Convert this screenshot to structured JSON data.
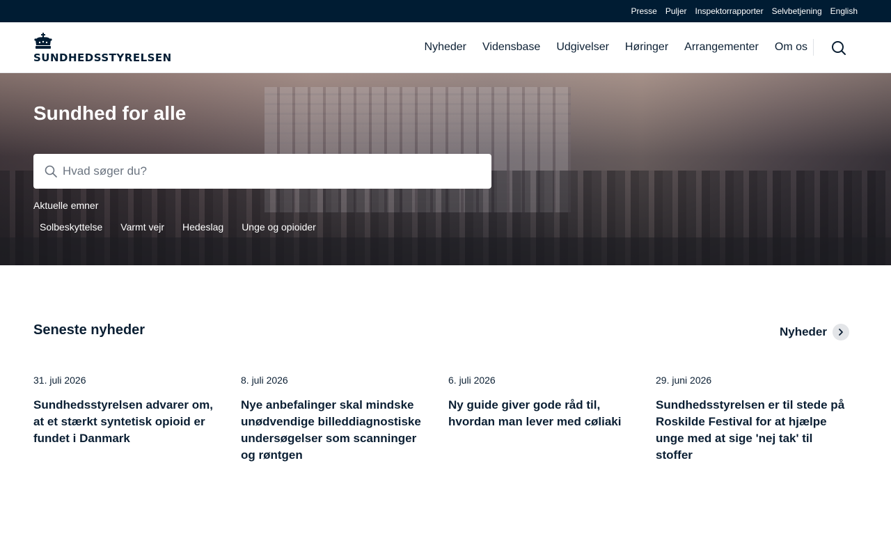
{
  "topbar": {
    "links": [
      "Presse",
      "Puljer",
      "Inspektorrapporter",
      "Selvbetjening",
      "English"
    ]
  },
  "header": {
    "logo_text": "SUNDHEDSSTYRELSEN",
    "nav": [
      "Nyheder",
      "Vidensbase",
      "Udgivelser",
      "Høringer",
      "Arrangementer",
      "Om os"
    ],
    "search_icon": "search-icon"
  },
  "hero": {
    "title": "Sundhed for alle",
    "search": {
      "placeholder": "Hvad søger du?",
      "value": ""
    },
    "topics_label": "Aktuelle emner",
    "topics": [
      "Solbeskyttelse",
      "Varmt vejr",
      "Hedeslag",
      "Unge og opioider"
    ]
  },
  "news": {
    "title": "Seneste nyheder",
    "more_label": "Nyheder",
    "items": [
      {
        "date": "31. juli 2026",
        "headline": "Sundhedsstyrelsen advarer om, at et stærkt syntetisk opioid er fundet i Danmark"
      },
      {
        "date": "8. juli 2026",
        "headline": "Nye anbefalinger skal mindske unødvendige billeddiagnostiske undersøgelser som scanninger og røntgen"
      },
      {
        "date": "6. juli 2026",
        "headline": "Ny guide giver gode råd til, hvordan man lever med cøliaki"
      },
      {
        "date": "29. juni 2026",
        "headline": "Sundhedsstyrelsen er til stede på Roskilde Festival for at hjælpe unge med at sige 'nej tak' til stoffer"
      }
    ]
  },
  "colors": {
    "topbar_bg": "#001c33",
    "text": "#0b1f33",
    "more_circle": "#e3e5e8"
  }
}
